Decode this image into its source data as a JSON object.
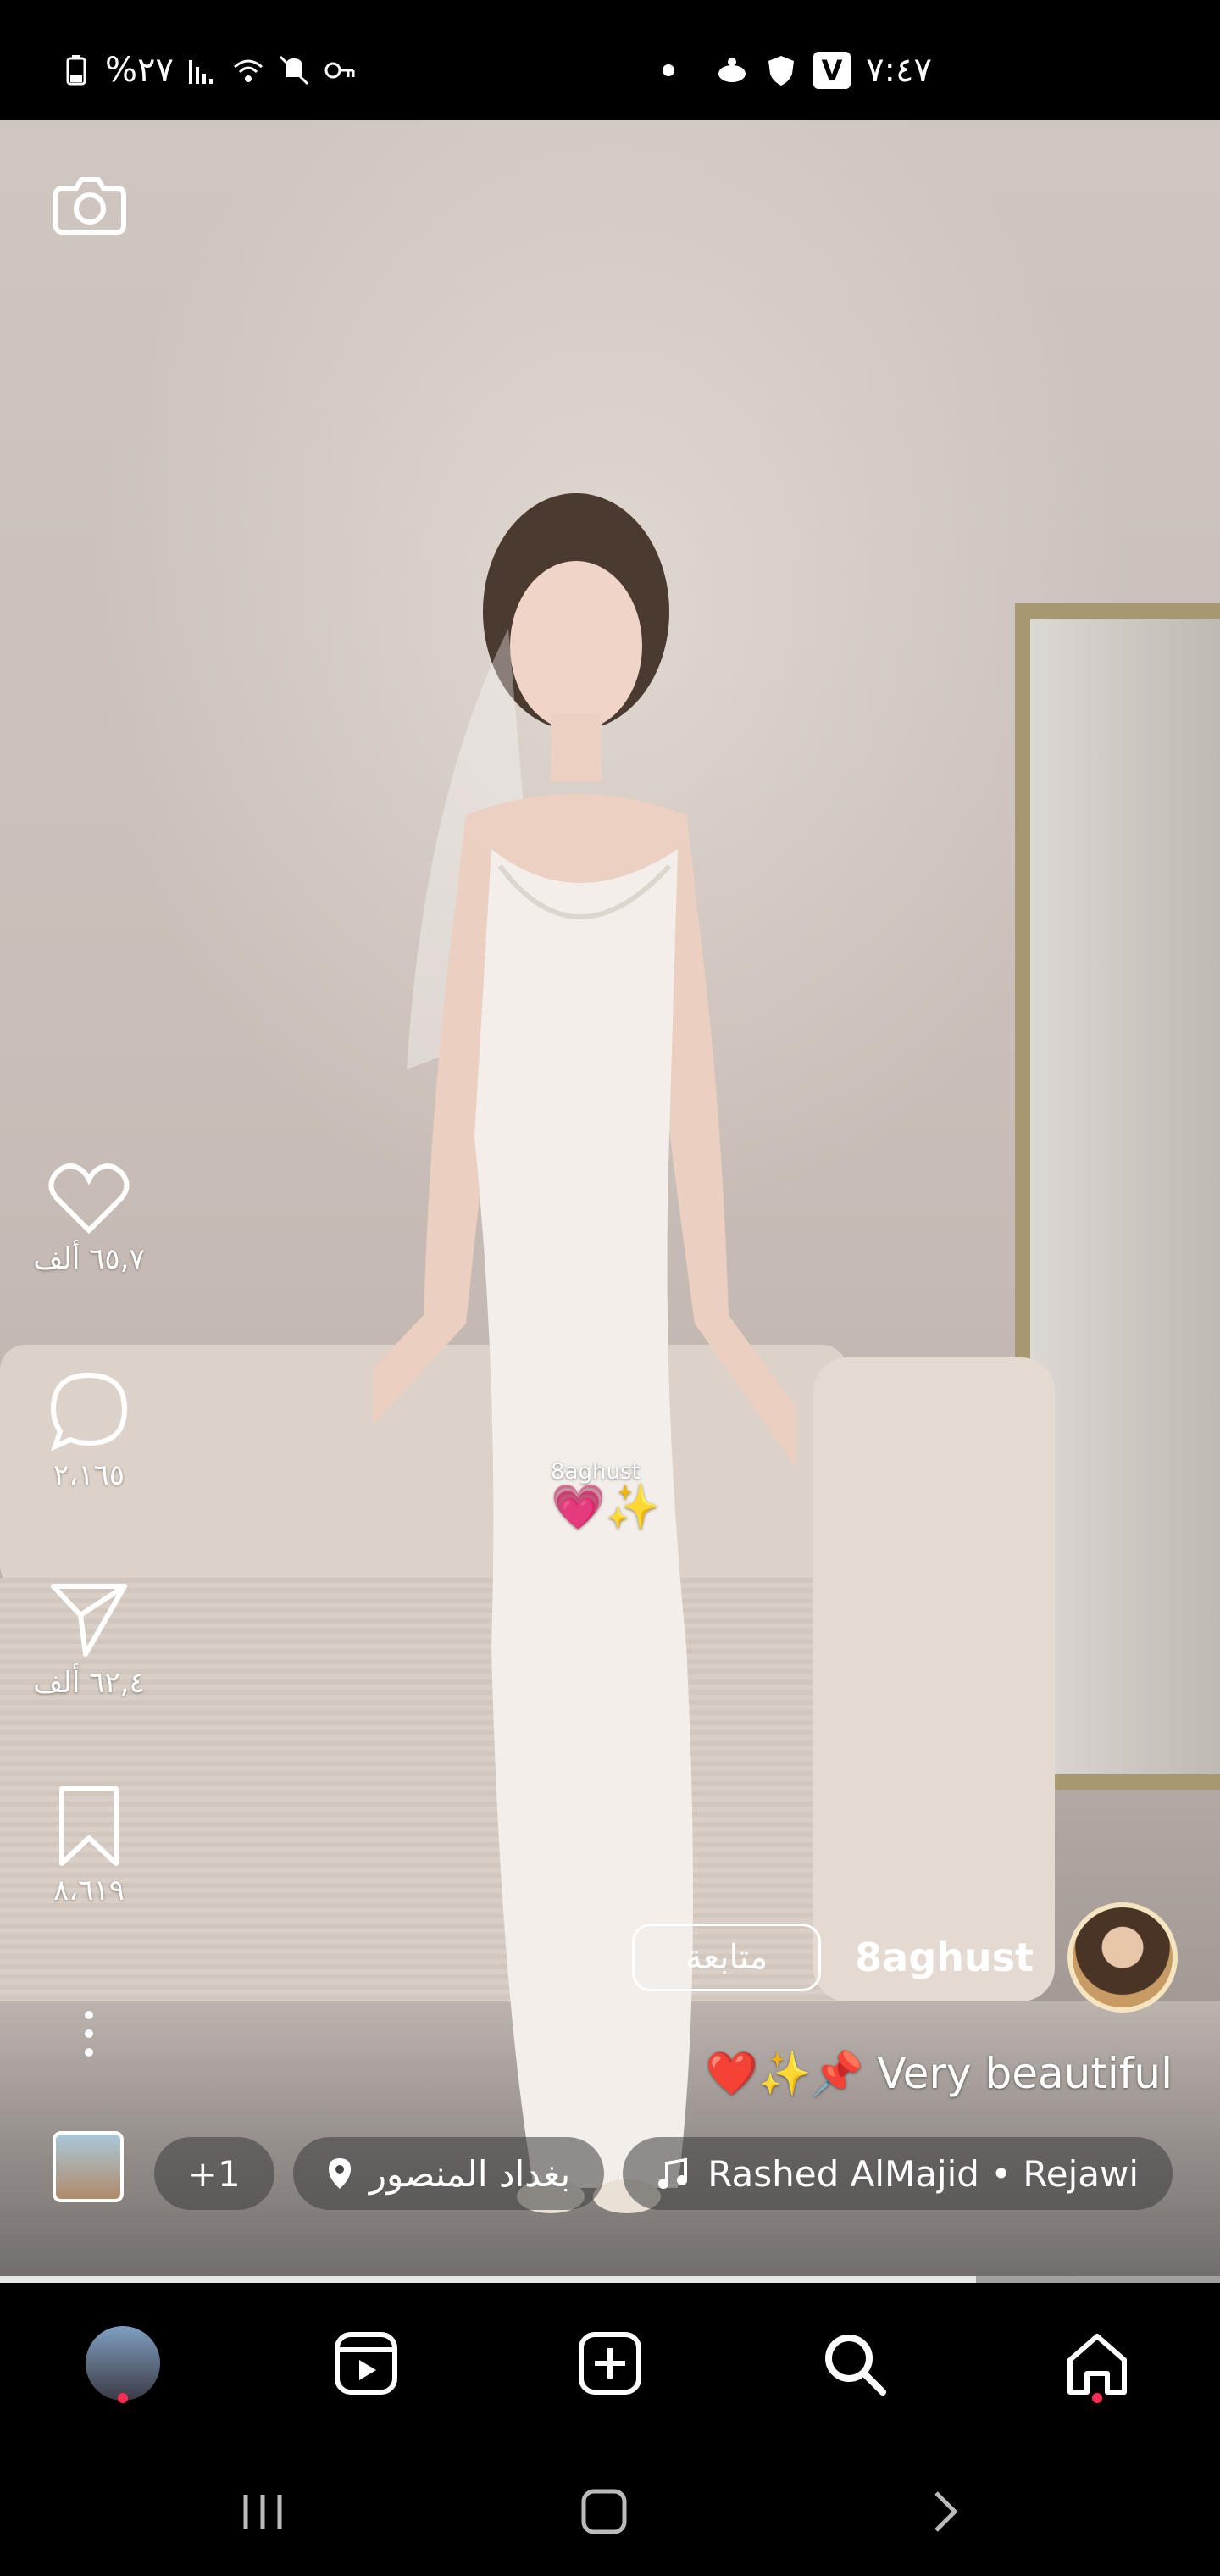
{
  "status_bar": {
    "battery": "%٢٧",
    "time": "٧:٤٧",
    "vpn_badge": "V"
  },
  "post": {
    "watermark_user": "8aghust",
    "watermark_emoji": "💗✨",
    "likes": "٦٥,٧ ألف",
    "comments": "٢،١٦٥",
    "shares": "٦٢,٤ ألف",
    "saves": "٨،٦١٩",
    "username": "8aghust",
    "follow_label": "متابعة",
    "caption": "❤️✨📌 Very beautiful",
    "music": "Rashed AlMajid • Rejawi",
    "location": "بغداد المنصور",
    "extra_count": "+1",
    "progress": 0.8
  },
  "icons": {
    "camera": "camera-icon",
    "like": "heart-icon",
    "comment": "comment-icon",
    "share": "send-icon",
    "save": "bookmark-icon",
    "more": "more-vertical-icon",
    "music": "music-note-icon",
    "location": "location-pin-icon"
  },
  "colors": {
    "nav_background": "#000000",
    "notification_dot": "#ff2d55"
  }
}
